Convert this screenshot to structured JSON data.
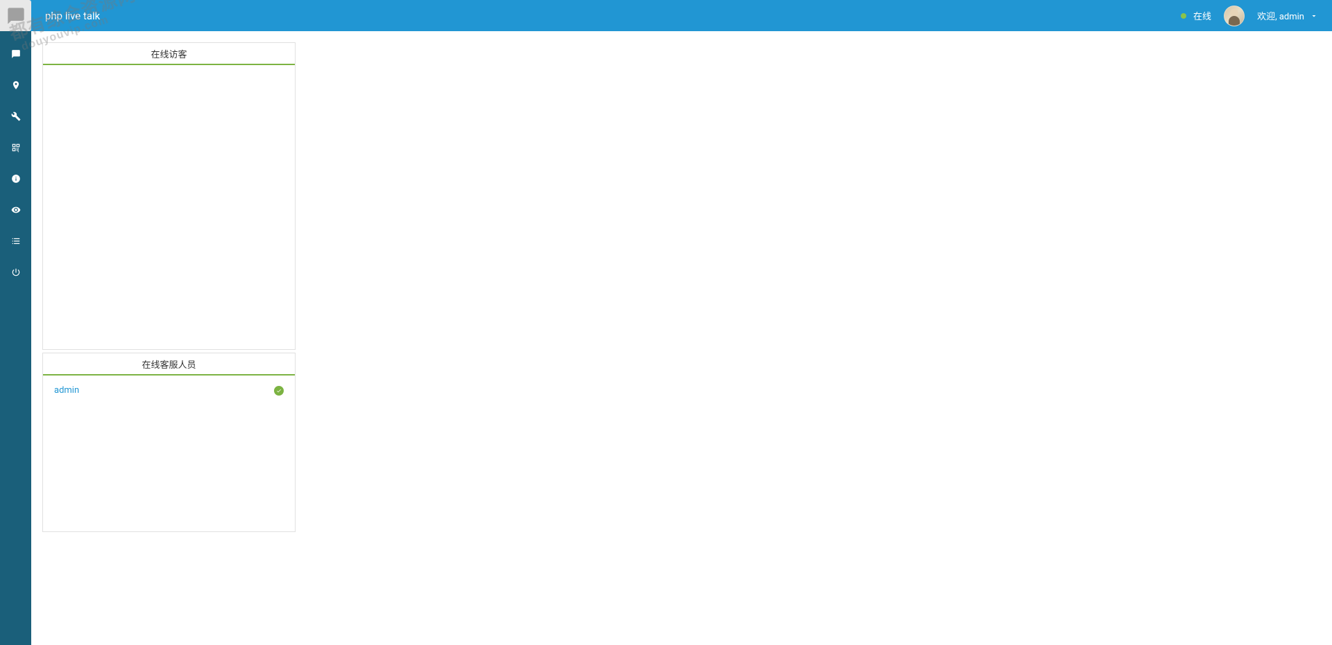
{
  "header": {
    "title": "php live talk",
    "status_text": "在线",
    "welcome_text": "欢迎, admin"
  },
  "sidebar": {
    "items": [
      {
        "icon": "chat"
      },
      {
        "icon": "pin"
      },
      {
        "icon": "wrench"
      },
      {
        "icon": "qrcode"
      },
      {
        "icon": "info"
      },
      {
        "icon": "eye"
      },
      {
        "icon": "list"
      },
      {
        "icon": "power"
      }
    ]
  },
  "panels": {
    "visitors": {
      "title": "在线访客"
    },
    "staff": {
      "title": "在线客服人员",
      "items": [
        {
          "name": "admin",
          "online": true
        }
      ]
    }
  },
  "watermark": {
    "line1": "都有综合资源网",
    "line2": "douyouvip.com"
  }
}
